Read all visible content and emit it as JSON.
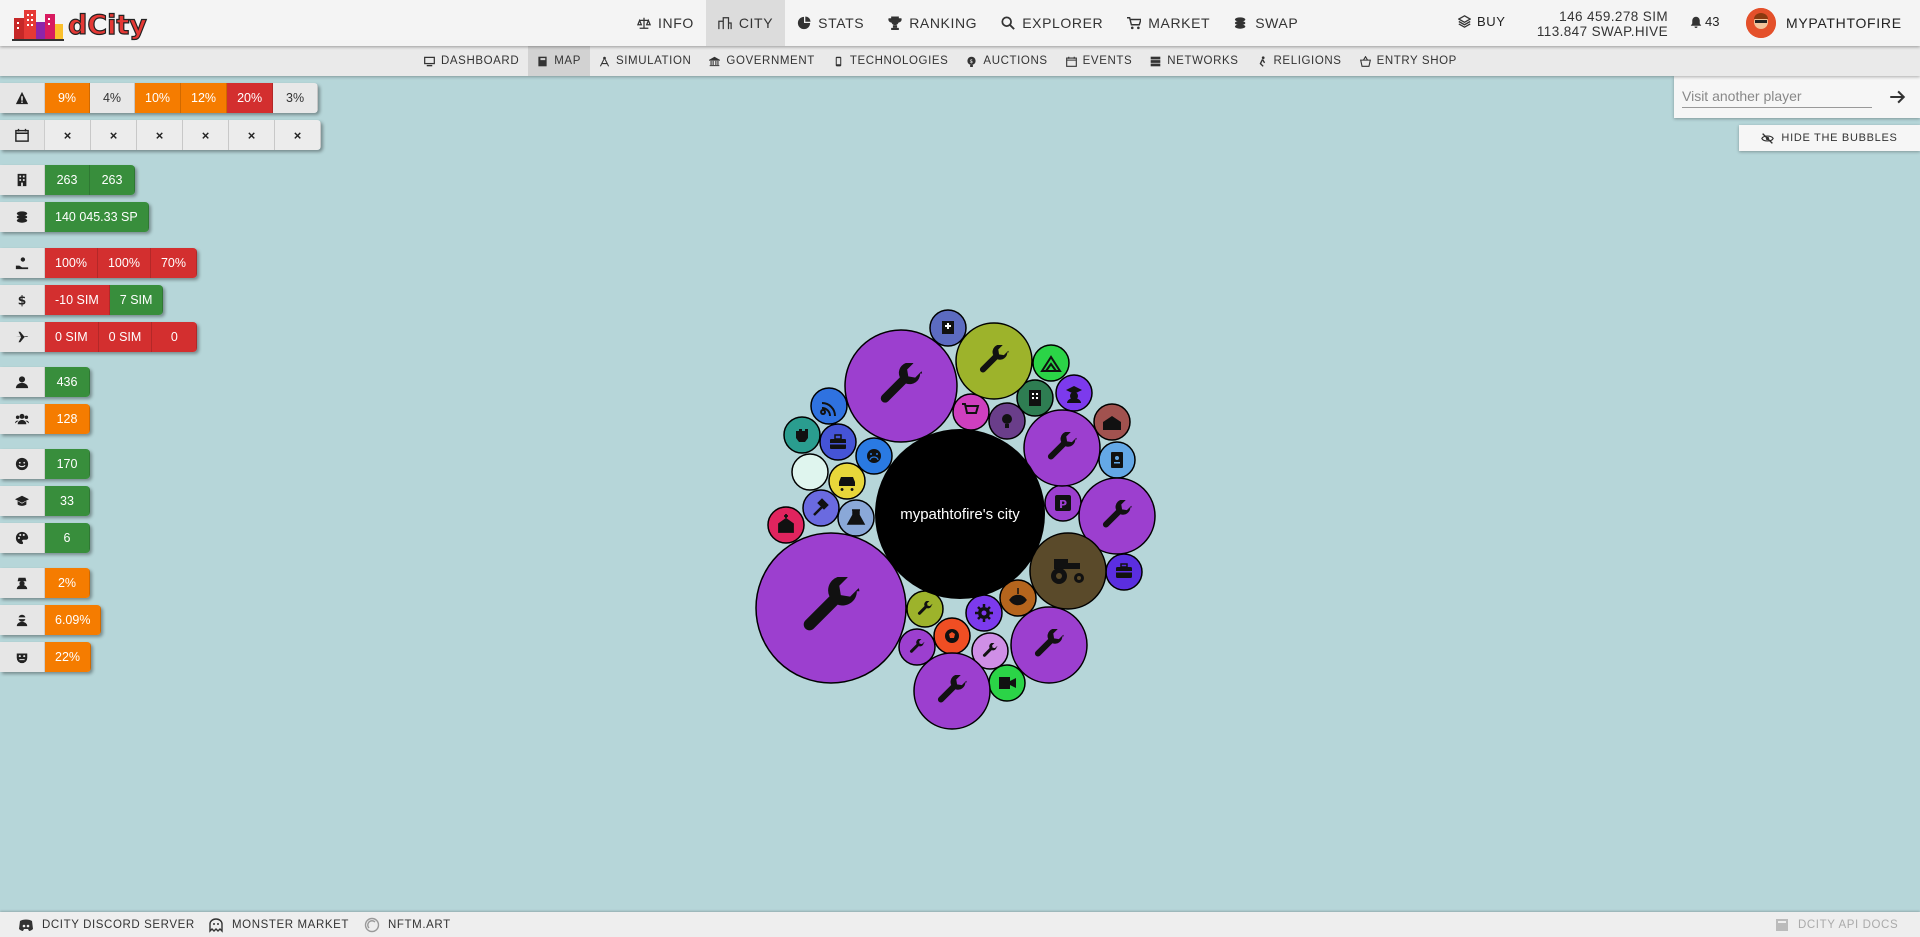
{
  "app": {
    "logo_text": "dCity"
  },
  "nav": [
    {
      "label": "INFO",
      "icon": "scale-icon"
    },
    {
      "label": "CITY",
      "icon": "city-icon",
      "active": true
    },
    {
      "label": "STATS",
      "icon": "pie-chart-icon"
    },
    {
      "label": "RANKING",
      "icon": "trophy-icon"
    },
    {
      "label": "EXPLORER",
      "icon": "search-icon"
    },
    {
      "label": "MARKET",
      "icon": "cart-icon"
    },
    {
      "label": "SWAP",
      "icon": "coins-icon"
    }
  ],
  "header": {
    "buy_label": "BUY",
    "balance_sim": "146 459.278 SIM",
    "balance_swap": "113.847 SWAP.HIVE",
    "notifications": "43",
    "username": "MYPATHTOFIRE"
  },
  "subnav": [
    {
      "label": "DASHBOARD",
      "icon": "monitor-icon"
    },
    {
      "label": "MAP",
      "icon": "book-icon",
      "active": true
    },
    {
      "label": "SIMULATION",
      "icon": "compass-icon"
    },
    {
      "label": "GOVERNMENT",
      "icon": "courthouse-icon"
    },
    {
      "label": "TECHNOLOGIES",
      "icon": "mobile-icon"
    },
    {
      "label": "AUCTIONS",
      "icon": "hammer-icon"
    },
    {
      "label": "EVENTS",
      "icon": "calendar-icon"
    },
    {
      "label": "NETWORKS",
      "icon": "server-icon"
    },
    {
      "label": "RELIGIONS",
      "icon": "praying-icon"
    },
    {
      "label": "ENTRY SHOP",
      "icon": "basket-icon"
    }
  ],
  "stats": {
    "risk": {
      "icon": "warning-icon",
      "values": [
        "9%",
        "4%",
        "10%",
        "12%",
        "20%",
        "3%"
      ]
    },
    "events": {
      "icon": "calendar-icon",
      "values": [
        "×",
        "×",
        "×",
        "×",
        "×",
        "×"
      ]
    },
    "buildings": {
      "icon": "building-icon",
      "values": [
        "263",
        "263"
      ]
    },
    "power": {
      "icon": "coins-icon",
      "values": [
        "140 045.33 SP"
      ]
    },
    "ratios": {
      "icon": "hand-coin-icon",
      "values": [
        "100%",
        "100%",
        "70%"
      ]
    },
    "income": {
      "icon": "dollar-icon",
      "values": [
        "-10 SIM",
        "7 SIM"
      ]
    },
    "tourism": {
      "icon": "plane-icon",
      "values": [
        "0 SIM",
        "0 SIM",
        "0"
      ]
    },
    "population": {
      "icon": "user-icon",
      "values": [
        "436"
      ]
    },
    "workers": {
      "icon": "users-icon",
      "values": [
        "128"
      ]
    },
    "happiness": {
      "icon": "smile-icon",
      "values": [
        "170"
      ]
    },
    "education": {
      "icon": "graduation-icon",
      "values": [
        "33"
      ]
    },
    "creativity": {
      "icon": "palette-icon",
      "values": [
        "6"
      ]
    },
    "unemployment": {
      "icon": "user-secret-icon",
      "values": [
        "2%"
      ]
    },
    "crime": {
      "icon": "thief-icon",
      "values": [
        "6.09%"
      ]
    },
    "pollution": {
      "icon": "mask-icon",
      "values": [
        "22%"
      ]
    }
  },
  "visit": {
    "placeholder": "Visit another player"
  },
  "hide_bubbles_label": "HIDE THE BUBBLES",
  "city": {
    "label": "mypathtofire's city"
  },
  "bubbles": [
    {
      "name": "wrench-large",
      "color": "#9c3fcf",
      "icon": "wrench-icon"
    },
    {
      "name": "wrench-top",
      "color": "#9c3fcf",
      "icon": "wrench-icon"
    },
    {
      "name": "wrench-olive",
      "color": "#9db32b",
      "icon": "wrench-icon"
    },
    {
      "name": "wrench-right-1",
      "color": "#9c3fcf",
      "icon": "wrench-icon"
    },
    {
      "name": "wrench-right-2",
      "color": "#9c3fcf",
      "icon": "wrench-icon"
    },
    {
      "name": "wrench-bottom-1",
      "color": "#9c3fcf",
      "icon": "wrench-icon"
    },
    {
      "name": "wrench-bottom-2",
      "color": "#9c3fcf",
      "icon": "wrench-icon"
    },
    {
      "name": "tractor",
      "color": "#5a4a2a",
      "icon": "tractor-icon"
    }
  ],
  "footer": [
    {
      "label": "DCITY DISCORD SERVER",
      "icon": "discord-icon"
    },
    {
      "label": "MONSTER MARKET",
      "icon": "monster-icon"
    },
    {
      "label": "NFTM.ART",
      "icon": "circle-icon"
    },
    {
      "label": "DCITY API DOCS",
      "icon": "api-icon"
    }
  ]
}
